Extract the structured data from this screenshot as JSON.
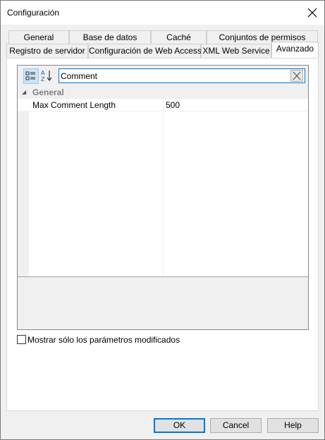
{
  "dialog": {
    "title": "Configuración"
  },
  "tabs_row1": [
    {
      "label": "General"
    },
    {
      "label": "Base de datos"
    },
    {
      "label": "Caché"
    },
    {
      "label": "Conjuntos de permisos"
    }
  ],
  "tabs_row2": [
    {
      "label": "Registro de servidor"
    },
    {
      "label": "Configuración de Web Access"
    },
    {
      "label": "XML Web Service"
    },
    {
      "label": "Avanzado",
      "active": true
    }
  ],
  "property_grid": {
    "search_value": "Comment",
    "categories": [
      {
        "name": "General",
        "properties": [
          {
            "name": "Max Comment Length",
            "value": "500"
          }
        ]
      }
    ]
  },
  "options": {
    "show_modified_label": "Mostrar sólo los parámetros modificados",
    "show_modified_checked": false
  },
  "buttons": {
    "ok": "OK",
    "cancel": "Cancel",
    "help": "Help"
  },
  "colors": {
    "accent": "#0078d7",
    "pressed_bg": "#cce4f7",
    "category_text": "#808080"
  },
  "icons": {
    "close": "close-icon",
    "categorized": "categorized-view-icon",
    "alphabetical": "sort-alphabetical-icon",
    "clear": "clear-search-icon"
  }
}
